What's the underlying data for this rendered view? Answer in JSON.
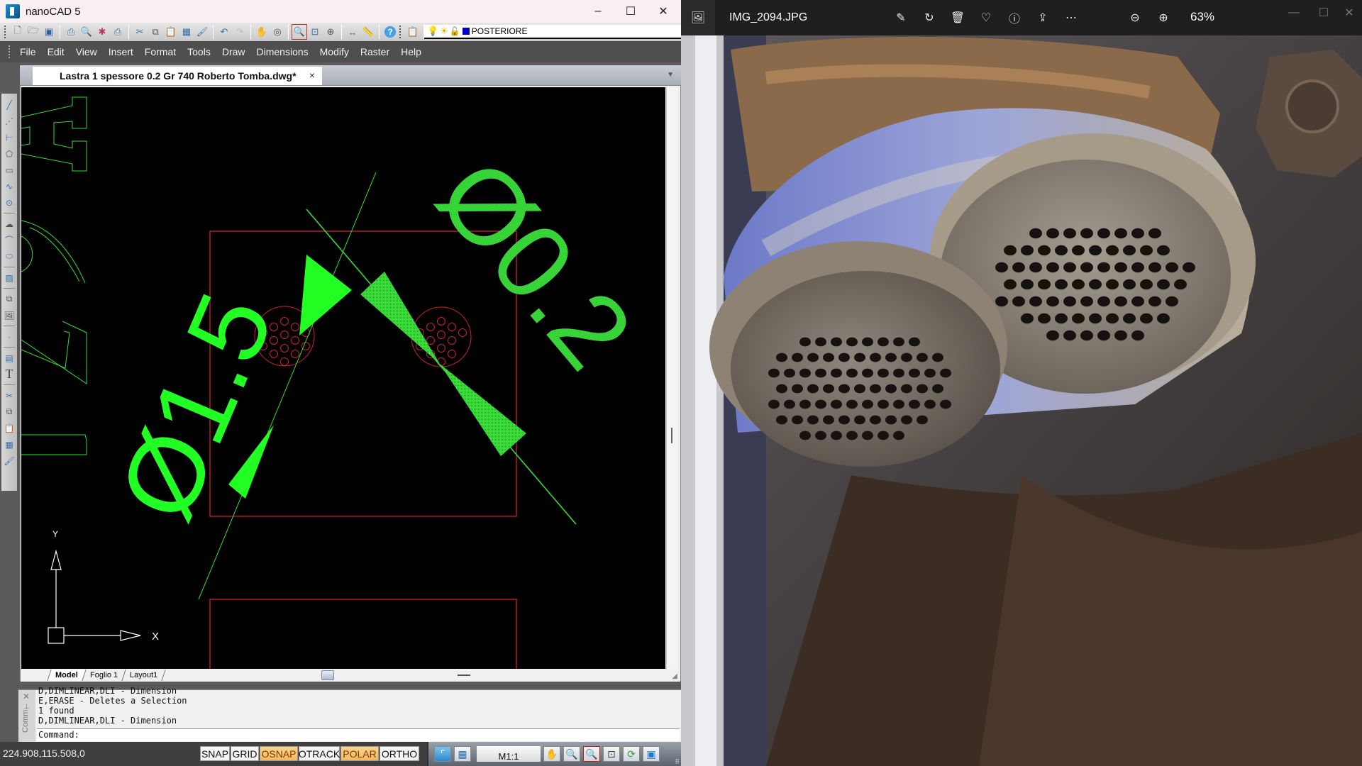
{
  "cad": {
    "window_title": "nanoCAD 5",
    "window_controls": {
      "minimize": "–",
      "maximize": "☐",
      "close": "✕"
    },
    "layer_name": "POSTERIORE",
    "layer_color": "#0000cc",
    "menu": [
      "File",
      "Edit",
      "View",
      "Insert",
      "Format",
      "Tools",
      "Draw",
      "Dimensions",
      "Modify",
      "Raster",
      "Help"
    ],
    "toolbar_icons": [
      "new-file-icon",
      "open-folder-icon",
      "save-icon",
      "plot-icon",
      "print-preview-icon",
      "publish-icon",
      "plot-setup-icon",
      "cut-icon",
      "copy-icon",
      "paste-icon",
      "match-properties-icon",
      "brush-icon",
      "undo-icon",
      "redo-icon",
      "pan-icon",
      "orbit-icon",
      "zoom-window-icon",
      "zoom-extents-icon",
      "zoom-realtime-icon",
      "dimension-icon",
      "measure-icon",
      "help-icon",
      "clipboard-icon",
      "settings-icon"
    ],
    "left_tools": [
      "line-icon",
      "polyline-icon",
      "multiline-icon",
      "polygon-icon",
      "rectangle-icon",
      "spline-icon",
      "circle-icon",
      "cloud-icon",
      "arc-icon",
      "ellipse-icon",
      "hatch-icon",
      "insert-block-icon",
      "insert-image-icon",
      "point-icon",
      "table-icon",
      "text-icon",
      "cut-icon",
      "copy-icon",
      "paste-icon",
      "properties-icon",
      "brush-icon"
    ],
    "document_tab": "Lastra 1 spessore 0.2 Gr 740 Roberto Tomba.dwg*",
    "document_tab_close": "×",
    "layout_tabs": [
      "Model",
      "Foglio 1",
      "Layout1"
    ],
    "active_layout": "Model",
    "drawing": {
      "dimension_left": "Ø1.5",
      "dimension_right": "Ø0.2",
      "ucs_x_label": "X",
      "ucs_y_label": "Y",
      "geometry_color": "#33ff33",
      "outline_color": "#d0202a"
    },
    "command_history": [
      "D,DIMLINEAR,DLI - Dimension",
      "E,ERASE - Deletes a Selection",
      "1 found",
      "D,DIMLINEAR,DLI - Dimension"
    ],
    "command_prompt": "Command:",
    "command_panel_label": "Comm",
    "coordinates": "224.908,115.508,0",
    "status_toggles": [
      {
        "label": "SNAP",
        "on": false
      },
      {
        "label": "GRID",
        "on": false
      },
      {
        "label": "OSNAP",
        "on": true
      },
      {
        "label": "OTRACK",
        "on": false
      },
      {
        "label": "POLAR",
        "on": true
      },
      {
        "label": "ORTHO",
        "on": false
      }
    ],
    "scale": "M1:1"
  },
  "photos": {
    "filename": "IMG_2094.JPG",
    "zoom_level": "63%",
    "toolbar": [
      "edit-image-icon",
      "rotate-icon",
      "delete-icon",
      "favorite-icon",
      "info-icon",
      "share-icon",
      "more-icon",
      "zoom-out-icon",
      "zoom-in-icon"
    ],
    "window_controls": {
      "minimize": "—",
      "maximize": "☐",
      "close": "✕"
    }
  }
}
